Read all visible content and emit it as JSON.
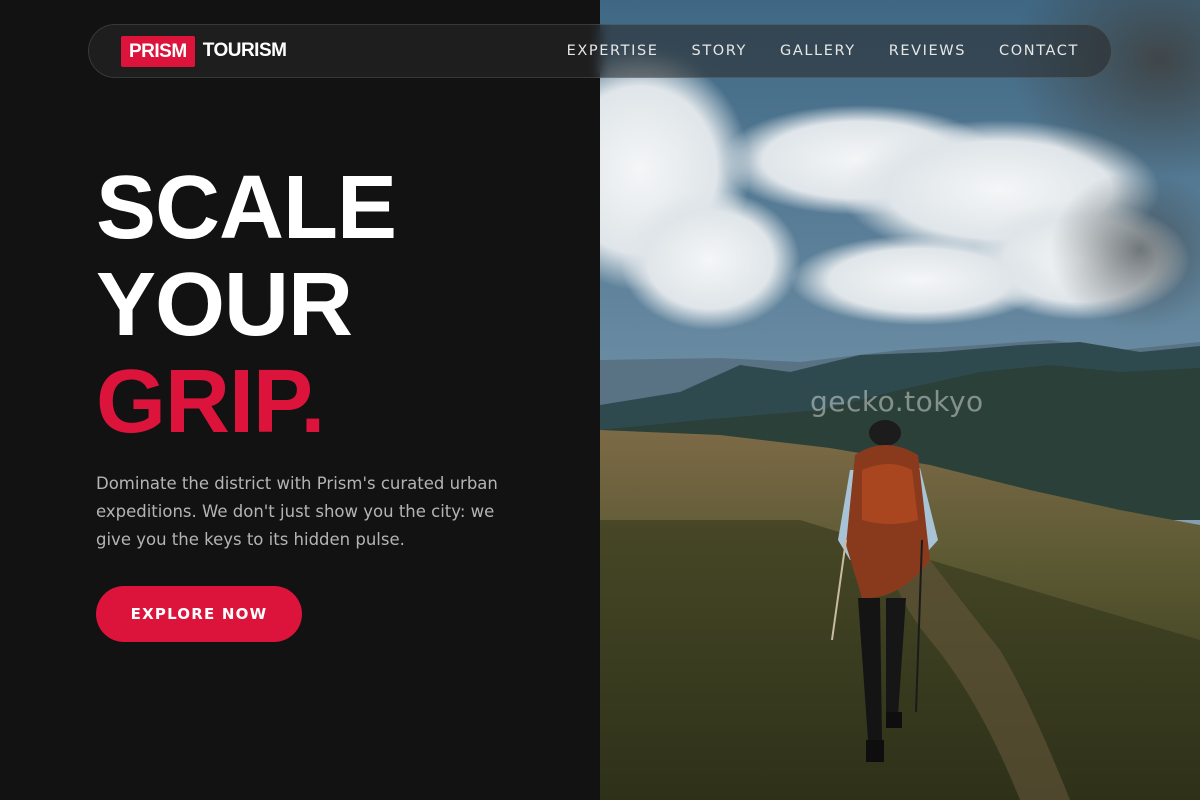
{
  "brand": {
    "logo_box": "PRISM",
    "logo_word": "TOURISM",
    "accent_color": "#dc143c"
  },
  "nav": {
    "items": [
      {
        "label": "EXPERTISE"
      },
      {
        "label": "STORY"
      },
      {
        "label": "GALLERY"
      },
      {
        "label": "REVIEWS"
      },
      {
        "label": "CONTACT"
      }
    ]
  },
  "hero": {
    "line1": "SCALE",
    "line2": "YOUR",
    "line3": "GRIP.",
    "description": "Dominate the district with Prism's curated urban expeditions. We don't just show you the city: we give you the keys to its hidden pulse.",
    "cta_label": "EXPLORE NOW"
  },
  "photo": {
    "watermark": "gecko.tokyo"
  }
}
